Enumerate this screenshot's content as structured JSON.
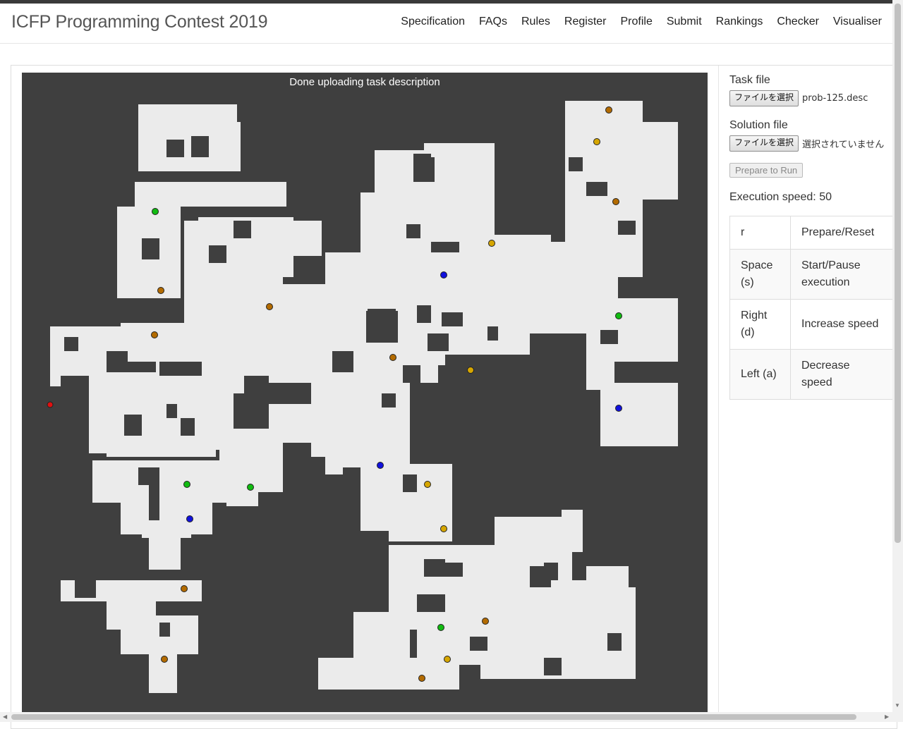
{
  "header": {
    "title": "ICFP Programming Contest 2019",
    "nav": [
      "Specification",
      "FAQs",
      "Rules",
      "Register",
      "Profile",
      "Submit",
      "Rankings",
      "Checker",
      "Visualiser"
    ]
  },
  "visualiser": {
    "status": "Done uploading task description",
    "boosters": [
      {
        "type": "manipulator",
        "color": "#d6a600"
      },
      {
        "type": "wheels",
        "color": "#b36b00"
      },
      {
        "type": "drill",
        "color": "#11bb11"
      },
      {
        "type": "teleport",
        "color": "#1111dd"
      },
      {
        "type": "robot",
        "color": "#e01010"
      }
    ],
    "colors": {
      "background": "#3f3f3f",
      "free": "#ebebeb",
      "obstacle": "#3f3f3f"
    }
  },
  "sidebar": {
    "task_label": "Task file",
    "task_button": "ファイルを選択",
    "task_filename": "prob-125.desc",
    "solution_label": "Solution file",
    "solution_button": "ファイルを選択",
    "solution_filename": "選択されていません",
    "prepare_button": "Prepare to Run",
    "execution_speed": "Execution speed: 50"
  },
  "controls": [
    {
      "key": "r",
      "action": "Prepare/Reset"
    },
    {
      "key": "Space (s)",
      "action": "Start/Pause execution"
    },
    {
      "key": "Right (d)",
      "action": "Increase speed"
    },
    {
      "key": "Left (a)",
      "action": "Decrease speed"
    }
  ]
}
